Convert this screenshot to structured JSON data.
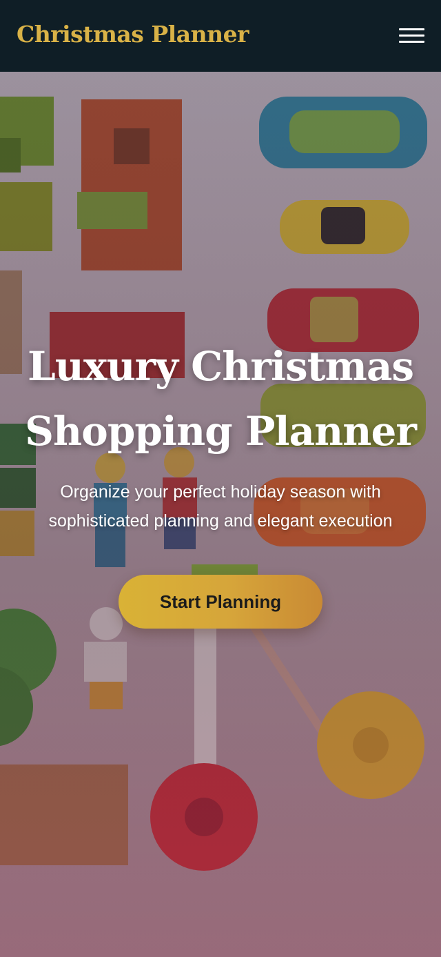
{
  "navbar": {
    "brand": "Christmas Planner",
    "menu_icon": "hamburger-menu-icon"
  },
  "hero": {
    "title": "Luxury Christmas Shopping Planner",
    "subtitle": "Organize your perfect holiday season with sophisticated planning and elegant execution",
    "cta_label": "Start Planning",
    "background_image": "flat-lay of toys: wooden blocks, toy cars, minifigures, wooden train track and toy wheels"
  },
  "colors": {
    "navbar_bg": "#0f1e26",
    "brand_gold": "#d9b247",
    "cta_gradient_start": "#d9b236",
    "cta_gradient_end": "#c98a34",
    "text_light": "#ffffff"
  }
}
